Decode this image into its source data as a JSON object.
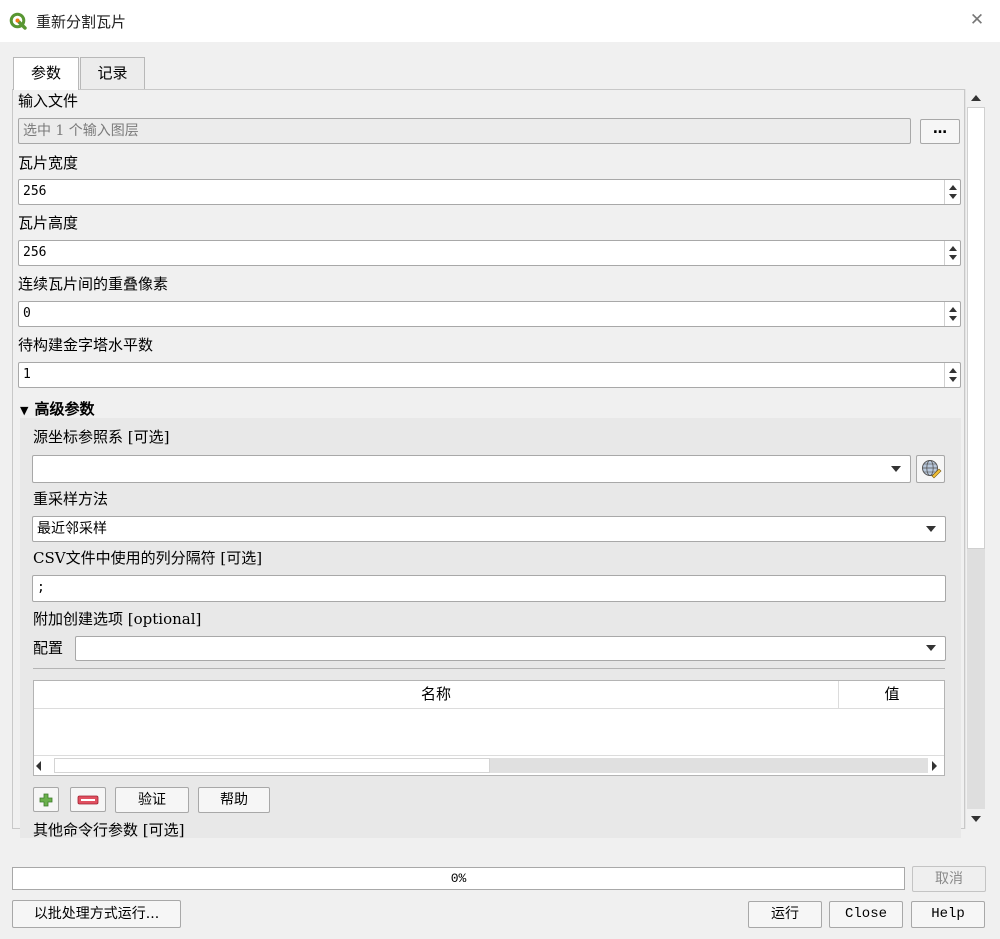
{
  "window": {
    "title": "重新分割瓦片",
    "close_glyph": "✕"
  },
  "tabs": [
    {
      "label": "参数",
      "active": true
    },
    {
      "label": "记录",
      "active": false
    }
  ],
  "params": {
    "input_files": {
      "label": "输入文件",
      "value": "选中 1 个输入图层",
      "button": "…"
    },
    "tile_width": {
      "label": "瓦片宽度",
      "value": "256"
    },
    "tile_height": {
      "label": "瓦片高度",
      "value": "256"
    },
    "overlap": {
      "label": "连续瓦片间的重叠像素",
      "value": "0"
    },
    "pyramid_levels": {
      "label": "待构建金字塔水平数",
      "value": "1"
    }
  },
  "advanced": {
    "header": "高级参数",
    "source_crs": {
      "label": "源坐标参照系 [可选]",
      "value": ""
    },
    "resampling": {
      "label": "重采样方法",
      "value": "最近邻采样"
    },
    "csv_delimiter": {
      "label": "CSV文件中使用的列分隔符 [可选]",
      "value": ";"
    },
    "creation_options": {
      "label": "附加创建选项 [optional]",
      "profile_label": "配置",
      "profile_value": "",
      "columns": [
        "名称",
        "值"
      ],
      "validate_button": "验证",
      "help_button": "帮助"
    },
    "next_label_partial": "其他命令行参数 [可选]"
  },
  "footer": {
    "progress_text": "0%",
    "progress": 0,
    "cancel": "取消",
    "batch": "以批处理方式运行...",
    "run": "运行",
    "close": "Close",
    "help": "Help"
  },
  "colors": {
    "accent_green": "#589632",
    "remove_red": "#d9314a",
    "window_bg": "#f0f0f0"
  },
  "icons": [
    "qgis-logo-icon",
    "close-icon",
    "spin-arrows-icon",
    "dropdown-arrow-icon",
    "crs-globe-icon",
    "add-row-icon",
    "remove-row-icon",
    "scroll-up-icon",
    "scroll-down-icon",
    "scroll-left-icon",
    "scroll-right-icon"
  ]
}
